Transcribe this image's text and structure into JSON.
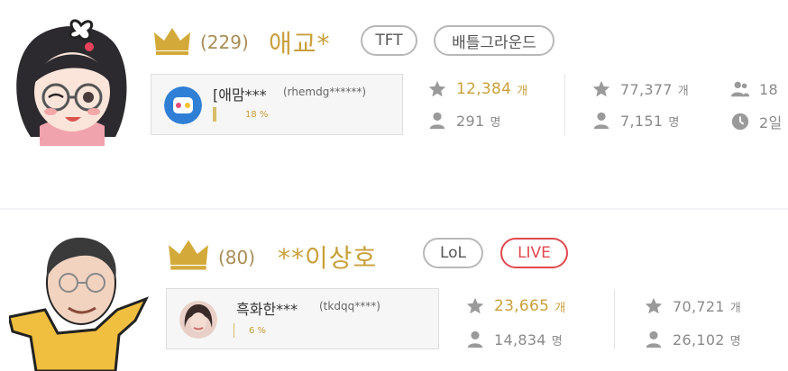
{
  "rows": [
    {
      "rank": "(229)",
      "name": "애교*",
      "tags": [
        "TFT",
        "배틀그라운드"
      ],
      "fan": {
        "name": "[애맘***",
        "id": "(rhemdg******)",
        "percent": "18 %",
        "fill": 0.18
      },
      "stats": {
        "stars": "12,384",
        "stars_unit": "개",
        "fans": "291",
        "fans_unit": "명",
        "total_stars": "77,377",
        "total_stars_unit": "개",
        "total_fans": "7,151",
        "total_fans_unit": "명",
        "extra_people": "18",
        "extra_time": "2일"
      }
    },
    {
      "rank": "(80)",
      "name": "**이상호",
      "tags": [
        "LoL",
        "LIVE"
      ],
      "fan": {
        "name": "흑화한***",
        "id": "(tkdqq****)",
        "percent": "6 %",
        "fill": 0.06
      },
      "stats": {
        "stars": "23,665",
        "stars_unit": "개",
        "fans": "14,834",
        "fans_unit": "명",
        "total_stars": "70,721",
        "total_stars_unit": "개",
        "total_fans": "26,102",
        "total_fans_unit": "명"
      }
    }
  ],
  "colors": {
    "gold": "#c9a03c",
    "live": "#e0484e",
    "gray": "#8a8a8a"
  },
  "icons": [
    "crown-icon",
    "star-icon",
    "person-icon",
    "people-icon",
    "clock-icon"
  ]
}
